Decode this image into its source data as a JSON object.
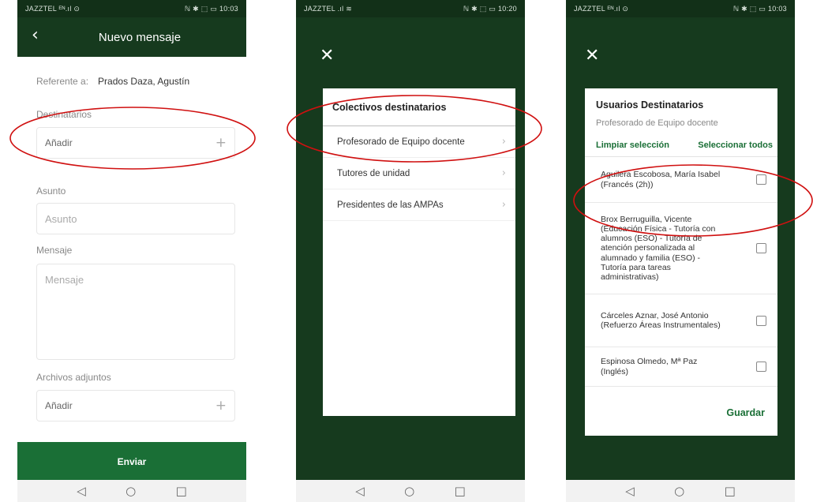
{
  "colors": {
    "brand": "#163a1e",
    "accent": "#1a6f36",
    "annotation": "#d01010"
  },
  "screens": [
    {
      "status": {
        "carrier": "JAZZTEL ᴱᴺ.ıl ⊙",
        "right": "ℕ ✱ ⬚ ▭ 10:03"
      },
      "header": {
        "back_icon": "‹",
        "title": "Nuevo mensaje"
      },
      "referente": {
        "label": "Referente a:",
        "value": "Prados Daza, Agustín"
      },
      "destinatarios": {
        "label": "Destinatarios",
        "add_label": "Añadir",
        "plus_icon": "+"
      },
      "asunto": {
        "label": "Asunto",
        "placeholder": "Asunto"
      },
      "mensaje": {
        "label": "Mensaje",
        "placeholder": "Mensaje"
      },
      "adjuntos": {
        "label": "Archivos adjuntos",
        "add_label": "Añadir",
        "plus_icon": "+"
      },
      "send_label": "Enviar"
    },
    {
      "status": {
        "carrier": "JAZZTEL .ıl ≋",
        "right": "ℕ ✱ ⬚ ▭ 10:20"
      },
      "close_icon": "✕",
      "title": "Colectivos destinatarios",
      "groups": [
        {
          "label": "Profesorado de Equipo docente"
        },
        {
          "label": "Tutores de unidad"
        },
        {
          "label": "Presidentes de las AMPAs"
        }
      ],
      "chevron_icon": "›"
    },
    {
      "status": {
        "carrier": "JAZZTEL ᴱᴺ.ıl ⊙",
        "right": "ℕ ✱ ⬚ ▭ 10:03"
      },
      "close_icon": "✕",
      "title": "Usuarios Destinatarios",
      "subtitle": "Profesorado de Equipo docente",
      "clear_label": "Limpiar selección",
      "select_all_label": "Seleccionar todos",
      "users": [
        {
          "name": "Aguilera Escobosa, María Isabel (Francés (2h))",
          "checked": false
        },
        {
          "name": "Brox Berruguilla, Vicente (Educación Física - Tutoría con alumnos (ESO) - Tutoría de atención personalizada al alumnado y familia (ESO) - Tutoría para tareas administrativas)",
          "checked": false
        },
        {
          "name": "Cárceles Aznar, José Antonio (Refuerzo Áreas Instrumentales)",
          "checked": false
        },
        {
          "name": "Espinosa Olmedo, Mª Paz (Inglés)",
          "checked": false
        }
      ],
      "save_label": "Guardar"
    }
  ],
  "navbar": {
    "back": "◁",
    "home": "○",
    "recent": "□"
  }
}
